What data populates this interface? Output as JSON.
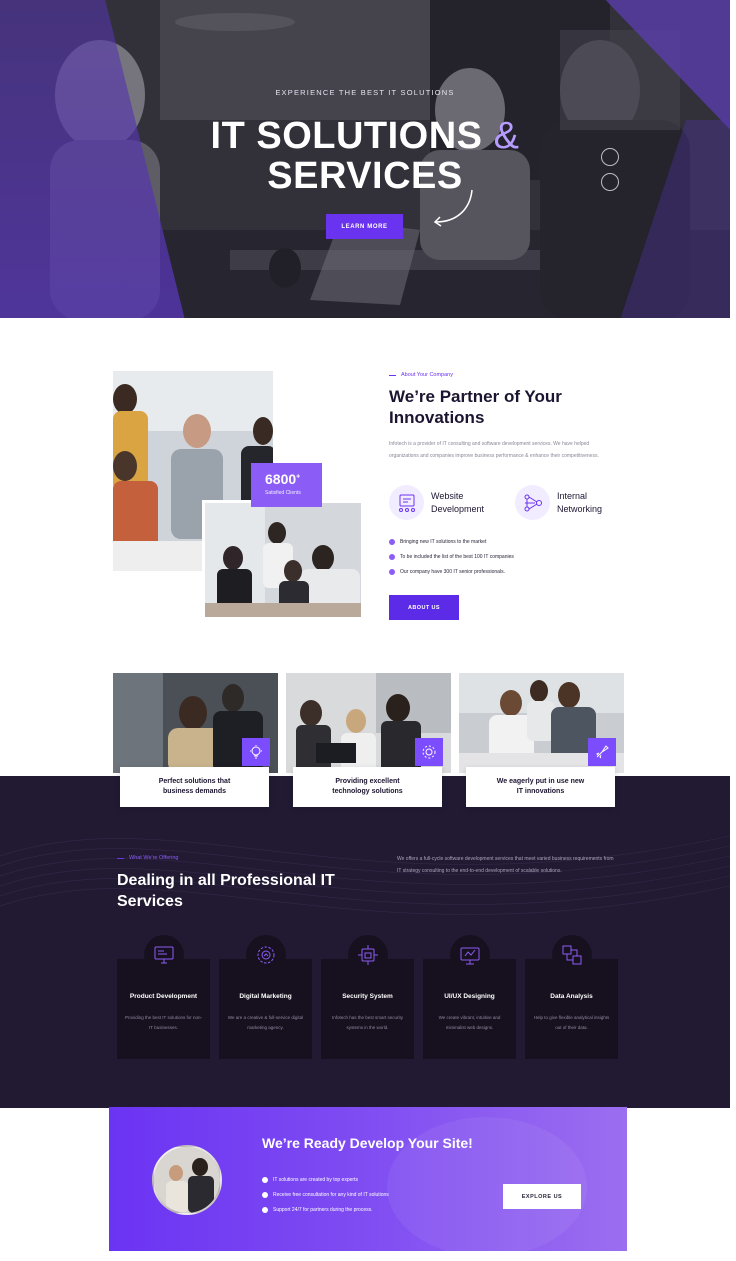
{
  "hero": {
    "kicker": "EXPERIENCE THE BEST IT SOLUTIONS",
    "title_line1": "IT SOLUTIONS",
    "title_amp": "&",
    "title_line2": "SERVICES",
    "button": "LEARN MORE"
  },
  "about": {
    "stat_number": "6800",
    "stat_sup": "+",
    "stat_label": "Satisfied Clients",
    "kicker": "About Your Company",
    "title": "We’re Partner of Your Innovations",
    "text": "Infotech is a provider of IT consulting and software development services. We have helped organizations and companies improve business performance & enhance their competitiveness.",
    "features": [
      {
        "label_line1": "Website",
        "label_line2": "Development",
        "icon": "website-development-icon"
      },
      {
        "label_line1": "Internal",
        "label_line2": "Networking",
        "icon": "network-icon"
      }
    ],
    "checks": [
      "Bringing new IT solutions to the market",
      "To be included the list of the best 100 IT companies",
      "Our company have 300 IT senior professionals."
    ],
    "button": "ABOUT US"
  },
  "cards": [
    {
      "caption_line1": "Perfect solutions that",
      "caption_line2": "business demands",
      "icon": "idea-icon"
    },
    {
      "caption_line1": "Providing excellent",
      "caption_line2": "technology solutions",
      "icon": "gear-icon"
    },
    {
      "caption_line1": "We eagerly put in use new",
      "caption_line2": "IT innovations",
      "icon": "launch-icon"
    }
  ],
  "services": {
    "kicker": "What We're Offering",
    "title": "Dealing in all Professional IT Services",
    "text": "We offers a full-cycle software development services that meet varied business requirements from IT strategy consulting to the end-to-end development of scalable solutions.",
    "items": [
      {
        "title": "Product Development",
        "text": "Providing the best IT solutions for non-IT businesses.",
        "icon": "monitor-icon"
      },
      {
        "title": "Digital Marketing",
        "text": "We are a creative & full-service digital marketing agency.",
        "icon": "cog-chart-icon"
      },
      {
        "title": "Security System",
        "text": "Infotech has the best smart security systems in the world.",
        "icon": "security-icon"
      },
      {
        "title": "UI/UX Designing",
        "text": "We create vibrant, intuitive and minimalist web designs.",
        "icon": "design-icon"
      },
      {
        "title": "Data Analysis",
        "text": "Help to give flexible analytical insights out of their data.",
        "icon": "data-analysis-icon"
      }
    ]
  },
  "cta": {
    "title": "We’re Ready Develop Your Site!",
    "points": [
      "IT solutions are created by top experts",
      "Receive free consultation for any kind of IT solutions",
      "Support 24/7 for partners during the process."
    ],
    "button": "EXPLORE US"
  },
  "colors": {
    "accent": "#6a33f0",
    "accent_light": "#8b5cf6",
    "dark_bg": "#221a33",
    "card_dark": "#17111f"
  }
}
